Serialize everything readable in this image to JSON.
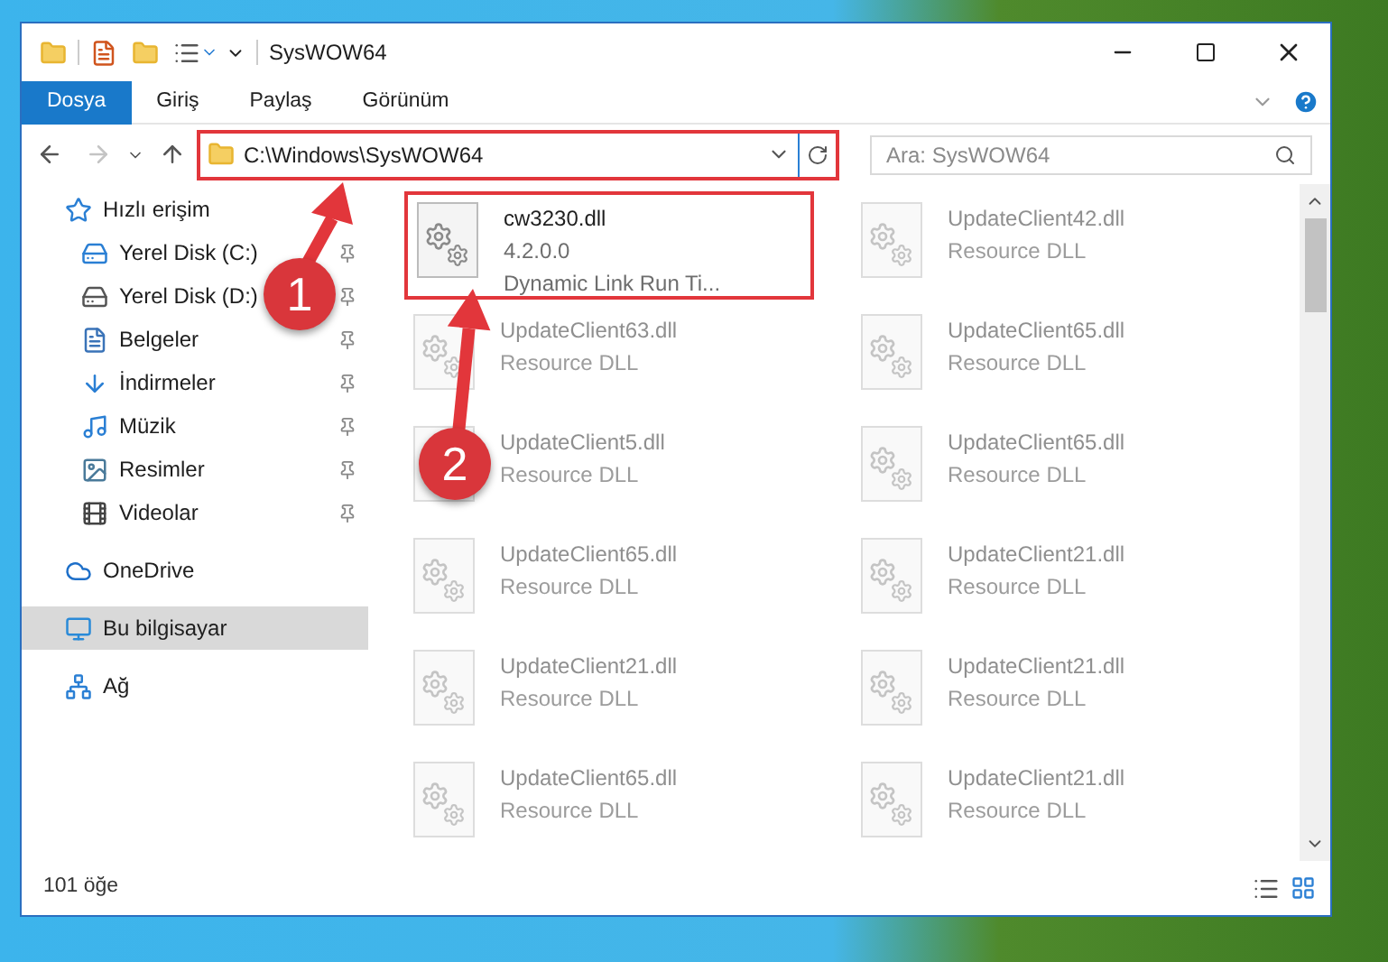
{
  "window": {
    "title": "SysWOW64"
  },
  "ribbon_tabs": [
    {
      "label": "Dosya",
      "selected": true
    },
    {
      "label": "Giriş",
      "selected": false
    },
    {
      "label": "Paylaş",
      "selected": false
    },
    {
      "label": "Görünüm",
      "selected": false
    }
  ],
  "address_bar": {
    "path": "C:\\Windows\\SysWOW64"
  },
  "search": {
    "placeholder": "Ara: SysWOW64"
  },
  "navigation": [
    {
      "label": "Hızlı erişim",
      "selected": false,
      "children": [
        {
          "label": "Yerel Disk (C:)",
          "selected": false,
          "pinned": true
        },
        {
          "label": "Yerel Disk (D:)",
          "selected": false,
          "pinned": true
        },
        {
          "label": "Belgeler",
          "selected": false,
          "pinned": true
        },
        {
          "label": "İndirmeler",
          "selected": false,
          "pinned": true
        },
        {
          "label": "Müzik",
          "selected": false,
          "pinned": true
        },
        {
          "label": "Resimler",
          "selected": false,
          "pinned": true
        },
        {
          "label": "Videolar",
          "selected": false,
          "pinned": true
        }
      ]
    },
    {
      "label": "OneDrive",
      "selected": false
    },
    {
      "label": "Bu bilgisayar",
      "selected": true
    },
    {
      "label": "Ağ",
      "selected": false
    }
  ],
  "files": [
    {
      "name": "cw3230.dll",
      "lines": [
        "4.2.0.0",
        "Dynamic Link Run Ti..."
      ],
      "blurred": false
    },
    {
      "name": "UpdateClient42.dll",
      "lines": [
        "Resource DLL"
      ],
      "blurred": true
    },
    {
      "name": "UpdateClient63.dll",
      "lines": [
        "Resource DLL"
      ],
      "blurred": true
    },
    {
      "name": "UpdateClient65.dll",
      "lines": [
        "Resource DLL"
      ],
      "blurred": true
    },
    {
      "name": "UpdateClient5.dll",
      "lines": [
        "Resource DLL"
      ],
      "blurred": true
    },
    {
      "name": "UpdateClient65.dll",
      "lines": [
        "Resource DLL"
      ],
      "blurred": true
    },
    {
      "name": "UpdateClient65.dll",
      "lines": [
        "Resource DLL"
      ],
      "blurred": true
    },
    {
      "name": "UpdateClient21.dll",
      "lines": [
        "Resource DLL"
      ],
      "blurred": true
    },
    {
      "name": "UpdateClient21.dll",
      "lines": [
        "Resource DLL"
      ],
      "blurred": true
    },
    {
      "name": "UpdateClient21.dll",
      "lines": [
        "Resource DLL"
      ],
      "blurred": true
    },
    {
      "name": "UpdateClient65.dll",
      "lines": [
        "Resource DLL"
      ],
      "blurred": true
    },
    {
      "name": "UpdateClient21.dll",
      "lines": [
        "Resource DLL"
      ],
      "blurred": true
    }
  ],
  "annotations": [
    {
      "label": "1"
    },
    {
      "label": "2"
    }
  ],
  "status_bar": {
    "count": "101 öğe"
  }
}
